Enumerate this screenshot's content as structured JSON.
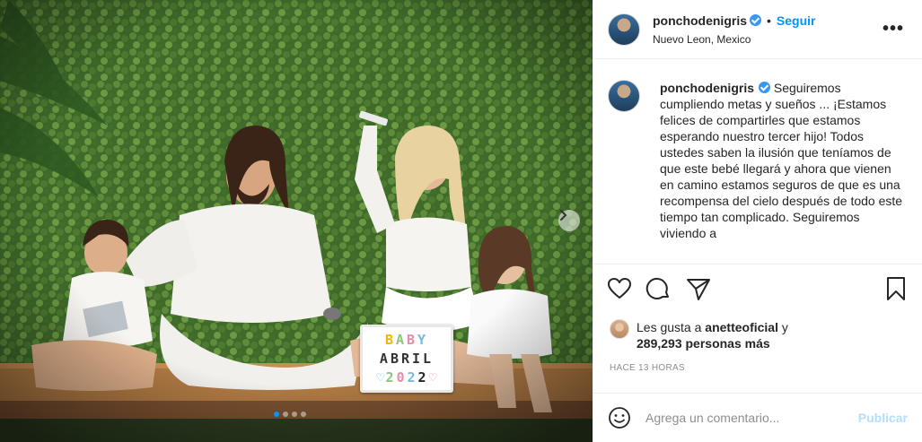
{
  "post": {
    "username": "ponchodenigris",
    "follow_label": "Seguir",
    "bullet": "•",
    "location": "Nuevo Leon, Mexico",
    "more_label": "•••"
  },
  "photo": {
    "lightbox": {
      "row1": [
        "B",
        "A",
        "B",
        "Y"
      ],
      "row2": "ABRIL",
      "row3": [
        "2",
        "0",
        "2",
        "2"
      ],
      "heart_left": "♥",
      "heart_right": "♡"
    },
    "carousel_dots": 4,
    "active_dot": 0
  },
  "caption": {
    "username": "ponchodenigris",
    "text": "Seguiremos cumpliendo metas y sueños ... ¡Estamos felices de compartirles que estamos esperando nuestro tercer hijo! Todos ustedes saben la ilusión que teníamos de que este bebé llegará y ahora que vienen en camino estamos seguros de que es una recompensa del cielo después de todo este tiempo tan complicado. Seguiremos viviendo a"
  },
  "likes": {
    "prefix": "Les gusta a",
    "liker": "anetteoficial",
    "conjunction": "y",
    "count": "289,293 personas más"
  },
  "timestamp": "HACE 13 HORAS",
  "comment": {
    "placeholder": "Agrega un comentario...",
    "publish_label": "Publicar"
  },
  "colors": {
    "accent": "#0095f6",
    "publish_disabled": "#b2dffc",
    "muted": "#8e8e8e",
    "verified": "#3897f0"
  }
}
